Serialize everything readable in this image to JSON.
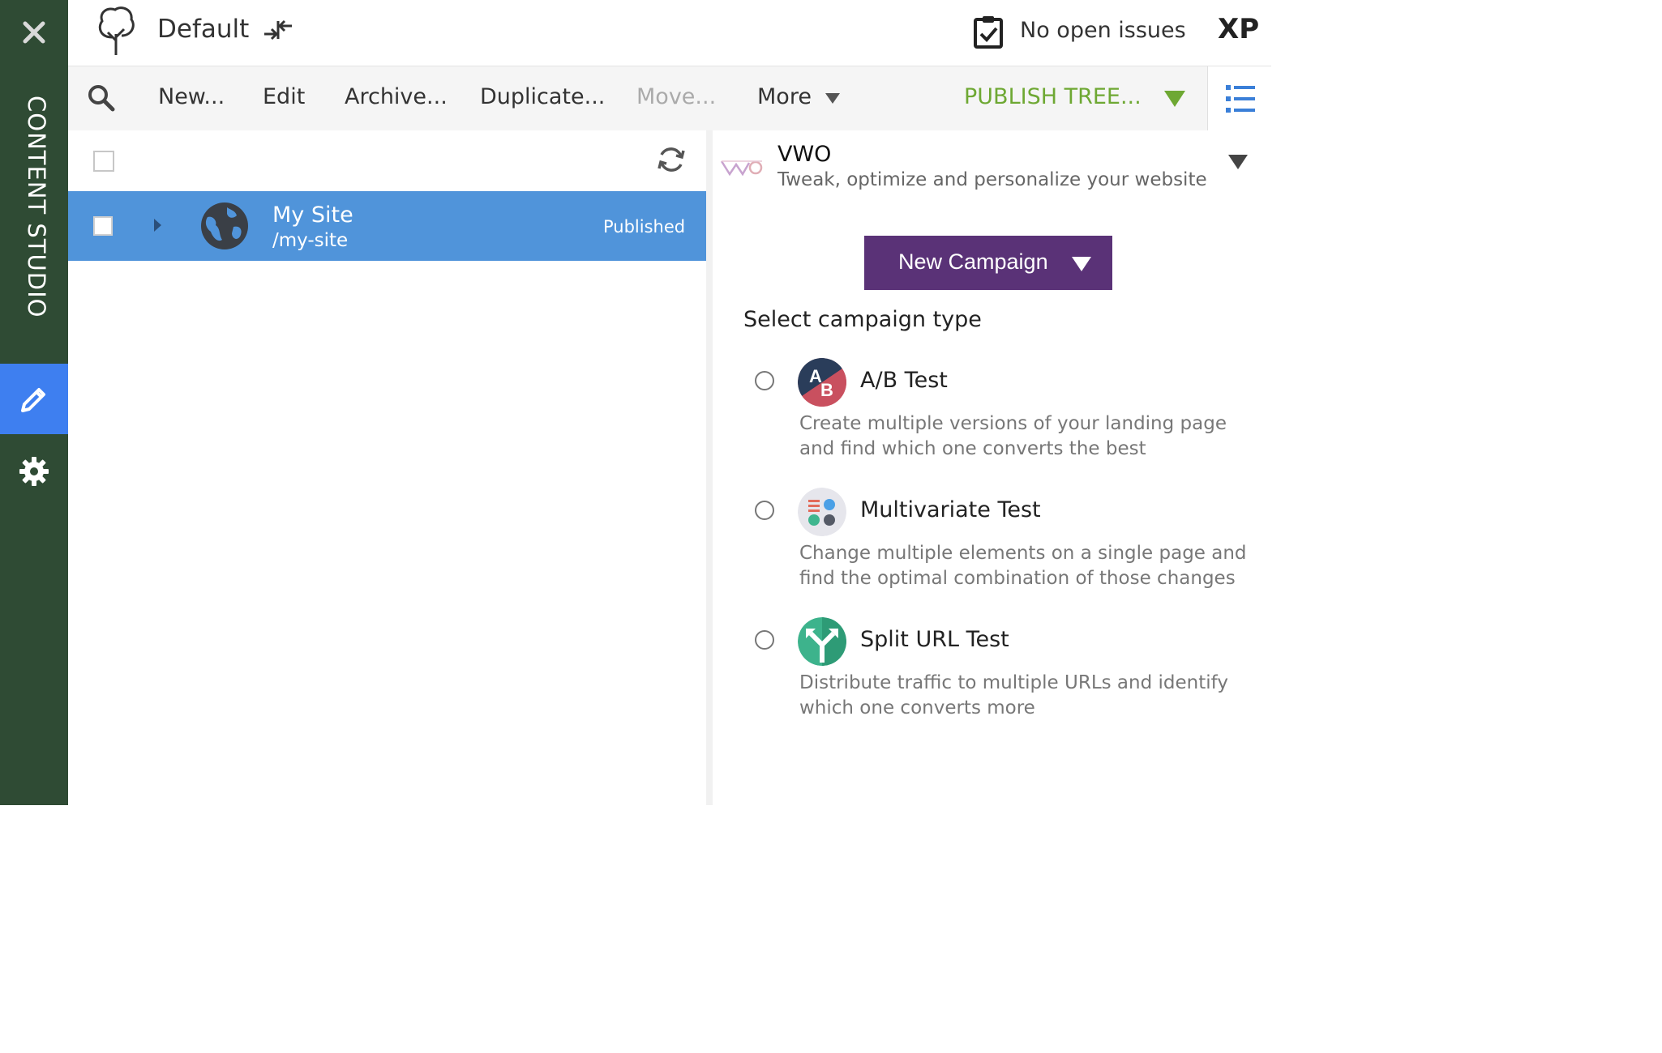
{
  "sidebar": {
    "app_label": "CONTENT STUDIO",
    "icons": [
      "close-icon",
      "pencil-icon",
      "gear-icon"
    ],
    "active_color": "#3e7ff0",
    "bg_color": "#2f4b34"
  },
  "header": {
    "project": "Default",
    "issues": "No open issues",
    "brand": "XP"
  },
  "toolbar": {
    "new": "New...",
    "edit": "Edit",
    "archive": "Archive...",
    "duplicate": "Duplicate...",
    "move": "Move...",
    "more": "More",
    "publish": "PUBLISH TREE...",
    "publish_color": "#6ea833"
  },
  "tree": {
    "rows": [
      {
        "name": "My Site",
        "path": "/my-site",
        "status": "Published",
        "icon": "globe-icon"
      }
    ],
    "selected_color": "#5094da"
  },
  "widget": {
    "title": "VWO",
    "subtitle": "Tweak, optimize and personalize your website",
    "new_campaign": "New Campaign",
    "button_color": "#5a3277",
    "select_heading": "Select campaign type",
    "campaign_types": [
      {
        "title": "A/B Test",
        "description": "Create multiple versions of your landing page and find which one converts the best",
        "icon": "ab-test-icon",
        "icon_text_a": "A",
        "icon_text_b": "B"
      },
      {
        "title": "Multivariate Test",
        "description": "Change multiple elements on a single page and find the optimal combination of those changes",
        "icon": "multivariate-test-icon"
      },
      {
        "title": "Split URL Test",
        "description": "Distribute traffic to multiple URLs and identify which one converts more",
        "icon": "split-url-test-icon"
      }
    ]
  }
}
